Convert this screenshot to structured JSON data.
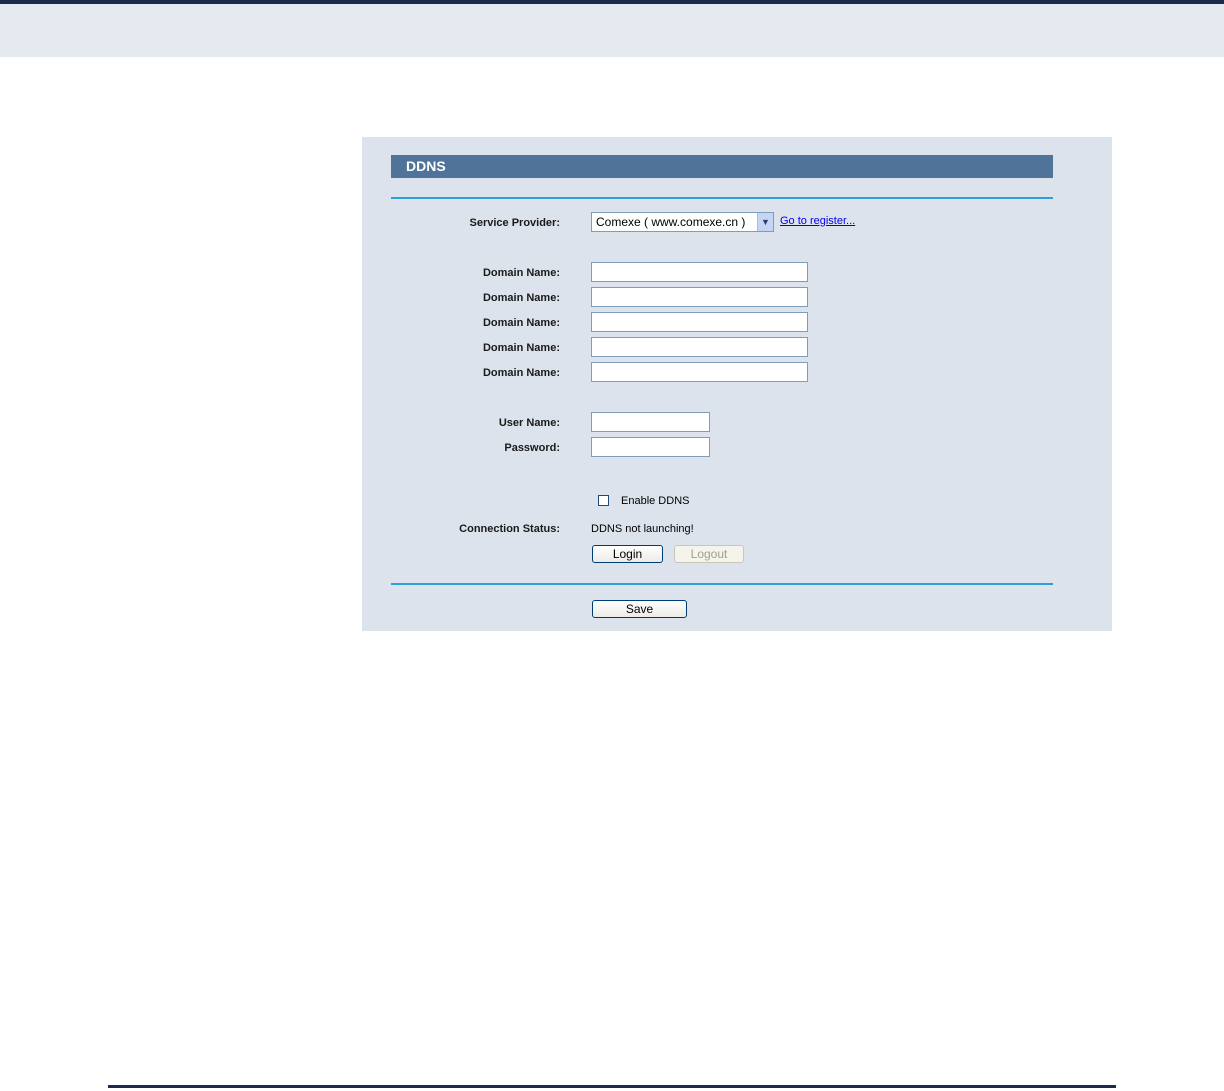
{
  "section": {
    "title": "DDNS"
  },
  "service_provider": {
    "label": "Service Provider:",
    "selected": "Comexe ( www.comexe.cn )",
    "register_link": "Go to register..."
  },
  "domain_names": [
    {
      "label": "Domain Name:",
      "value": ""
    },
    {
      "label": "Domain Name:",
      "value": ""
    },
    {
      "label": "Domain Name:",
      "value": ""
    },
    {
      "label": "Domain Name:",
      "value": ""
    },
    {
      "label": "Domain Name:",
      "value": ""
    }
  ],
  "username": {
    "label": "User Name:",
    "value": ""
  },
  "password": {
    "label": "Password:",
    "value": ""
  },
  "enable_ddns": {
    "label": "Enable DDNS",
    "checked": false
  },
  "connection_status": {
    "label": "Connection Status:",
    "value": "DDNS not launching!"
  },
  "buttons": {
    "login": "Login",
    "logout": "Logout",
    "save": "Save"
  },
  "colors": {
    "header": "#50739a",
    "panel": "#dde3ec",
    "divider": "#2e9fd8",
    "top_band": "#e5e9f0"
  }
}
